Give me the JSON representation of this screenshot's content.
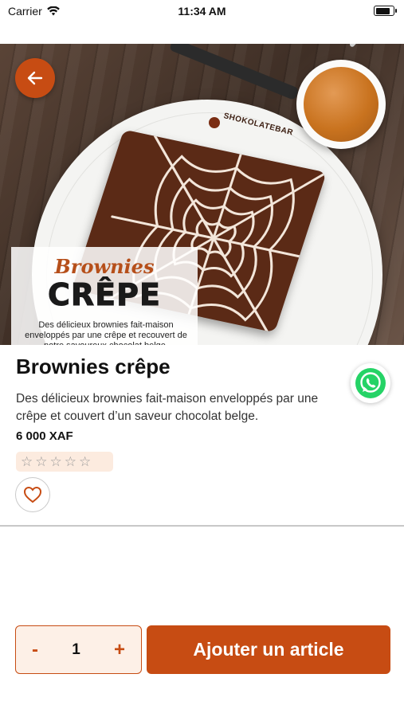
{
  "status_bar": {
    "carrier": "Carrier",
    "time": "11:34 AM",
    "battery_level": 0.95
  },
  "hero": {
    "overlay_title_script": "Brownies",
    "overlay_title_main": "CRÊPE",
    "overlay_desc": "Des délicieux brownies fait-maison enveloppés par une crêpe et recouvert de notre savoureux chocolat belge.",
    "logo_text": "SHOKOLATEBAR"
  },
  "icons": {
    "back": "arrow-left-icon",
    "whatsapp": "whatsapp-icon",
    "favorite": "heart-outline-icon",
    "star": "star-outline-icon"
  },
  "product": {
    "title": "Brownies crêpe",
    "description": "Des délicieux brownies fait-maison enveloppés par une crêpe et couvert d’un saveur chocolat belge.",
    "price": "6 000 XAF",
    "rating": 0,
    "rating_max": 5
  },
  "cart": {
    "minus_label": "-",
    "quantity": "1",
    "plus_label": "+",
    "add_label": "Ajouter un article"
  },
  "colors": {
    "accent": "#c74c13",
    "accent_light": "#fdf0e7",
    "rating_bg": "#fcebdf",
    "whatsapp": "#25d366"
  }
}
